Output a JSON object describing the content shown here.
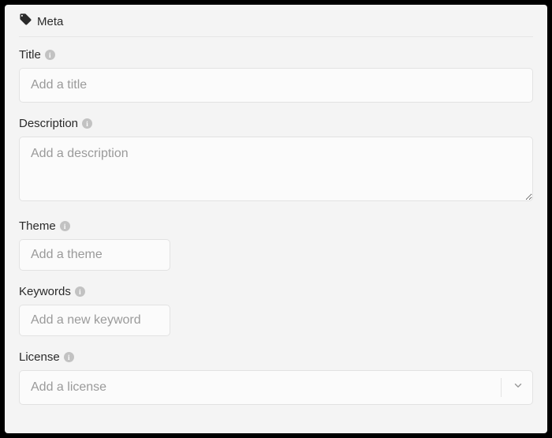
{
  "section": {
    "title": "Meta"
  },
  "fields": {
    "title": {
      "label": "Title",
      "placeholder": "Add a title",
      "value": ""
    },
    "description": {
      "label": "Description",
      "placeholder": "Add a description",
      "value": ""
    },
    "theme": {
      "label": "Theme",
      "placeholder": "Add a theme",
      "value": ""
    },
    "keywords": {
      "label": "Keywords",
      "placeholder": "Add a new keyword",
      "value": ""
    },
    "license": {
      "label": "License",
      "placeholder": "Add a license",
      "value": ""
    }
  },
  "info_glyph": "i"
}
